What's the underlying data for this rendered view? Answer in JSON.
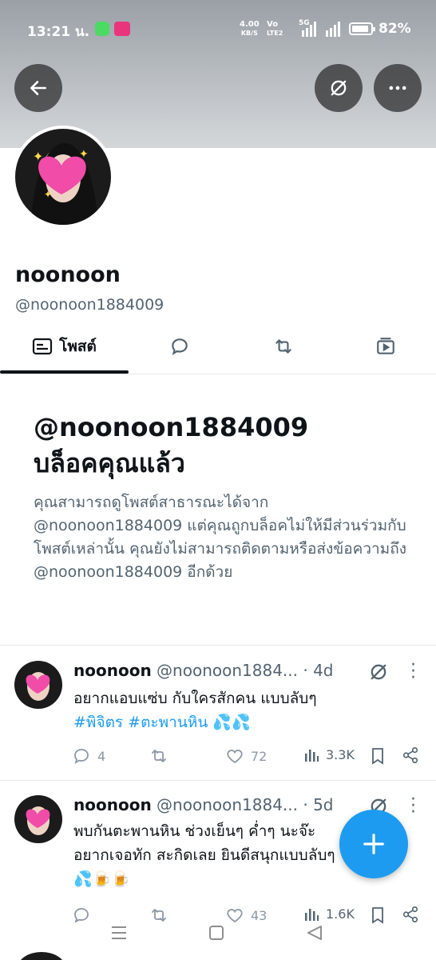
{
  "status_bar": {
    "time": "13:21 น.",
    "net_speed_value": "4.00",
    "net_speed_unit": "KB/S",
    "volte_top": "Vo",
    "volte_bottom": "LTE2",
    "network": "5G",
    "battery": "82%"
  },
  "header": {
    "back_icon": "arrow-left-icon",
    "notify_icon": "bell-slash-icon",
    "more_icon": "more-horizontal-icon"
  },
  "profile": {
    "name": "noonoon",
    "handle": "@noonoon1884009"
  },
  "tabs": [
    {
      "label": "โพสต์",
      "icon": "posts-icon",
      "active": true
    },
    {
      "label": "",
      "icon": "reply-icon",
      "active": false
    },
    {
      "label": "",
      "icon": "repost-icon",
      "active": false
    },
    {
      "label": "",
      "icon": "media-icon",
      "active": false
    }
  ],
  "blocked": {
    "title_line1": "@noonoon1884009",
    "title_line2": "บล็อคคุณแล้ว",
    "description": "คุณสามารถดูโพสต์สาธารณะได้จาก @noonoon1884009 แต่คุณถูกบล็อคไม่ให้มีส่วนร่วมกับโพสต์เหล่านั้น คุณยังไม่สามารถติดตามหรือส่งข้อความถึง @noonoon1884009 อีกด้วย"
  },
  "posts": [
    {
      "name": "noonoon",
      "handle": "@noonoon1884...",
      "time": "· 4d",
      "text": "อยากแอบแซ่บ กับใครสักคน แบบลับๆ",
      "tags": "#พิจิตร #ตะพานหิน 💦💦",
      "replies": "4",
      "reposts": "",
      "likes": "72",
      "views": "3.3K"
    },
    {
      "name": "noonoon",
      "handle": "@noonoon1884...",
      "time": "· 5d",
      "text_line1": "พบกันตะพานหิน ช่วงเย็นๆ ค่ำๆ นะจ๊ะ",
      "text_line2": "อยากเจอทัก สะกิดเลย ยินดีสนุกแบบลับๆ",
      "text_line3": "💦🍺🍺",
      "replies": "",
      "reposts": "",
      "likes": "43",
      "views": "1.6K"
    }
  ],
  "fab": {
    "icon": "plus-icon"
  },
  "nav": {
    "recent": "menu-icon",
    "home": "home-square-icon",
    "back": "back-triangle-icon"
  },
  "colors": {
    "accent": "#1d9bf0",
    "secondary_text": "#536471",
    "action_icons": "#8b98a5"
  }
}
